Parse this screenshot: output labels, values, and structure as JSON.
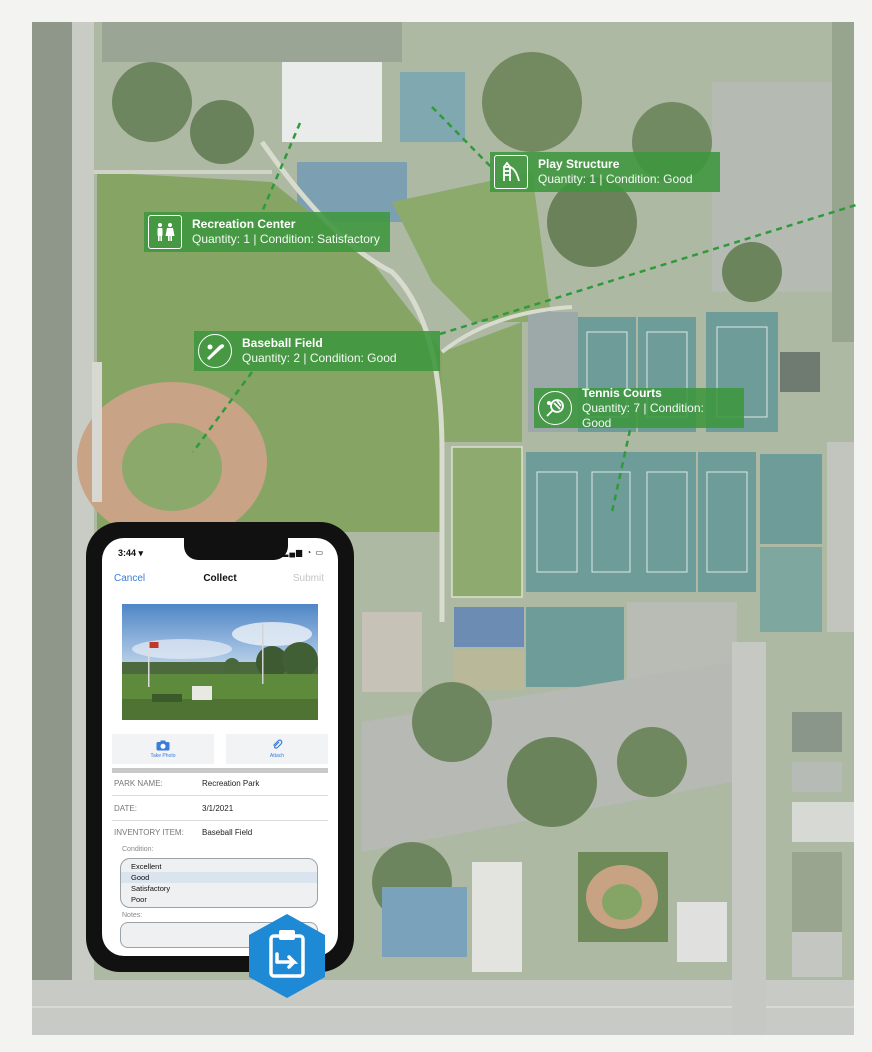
{
  "callouts": {
    "recreation": {
      "title": "Recreation Center",
      "subtitle": "Quantity: 1 | Condition: Satisfactory",
      "icon": "restroom-icon"
    },
    "play": {
      "title": "Play Structure",
      "subtitle": "Quantity: 1 | Condition: Good",
      "icon": "slide-icon"
    },
    "baseball": {
      "title": "Baseball Field",
      "subtitle": "Quantity: 2 | Condition: Good",
      "icon": "baseball-bat-icon"
    },
    "tennis": {
      "title": "Tennis Courts",
      "subtitle": "Quantity: 7 | Condition: Good",
      "icon": "tennis-racket-icon"
    }
  },
  "phone": {
    "status": {
      "time": "3:44 ▾",
      "signals": "▂▄▆ ◔ ▭"
    },
    "nav": {
      "cancel": "Cancel",
      "title": "Collect",
      "submit": "Submit"
    },
    "actions": {
      "take_photo": "Take Photo",
      "attach": "Attach"
    },
    "form": {
      "park_name_label": "PARK NAME:",
      "park_name_value": "Recreation Park",
      "date_label": "DATE:",
      "date_value": "3/1/2021",
      "item_label": "INVENTORY ITEM:",
      "item_value": "Baseball Field",
      "condition_label": "Condition:",
      "condition_options": [
        "Excellent",
        "Good",
        "Satisfactory",
        "Poor"
      ],
      "condition_selected": "Good",
      "notes_label": "Notes:"
    }
  },
  "colors": {
    "callout_green": "#3e963e",
    "link_blue": "#3b7dd8",
    "badge_blue": "#1e8ad6"
  },
  "badge_icon": "clipboard-collect-icon"
}
